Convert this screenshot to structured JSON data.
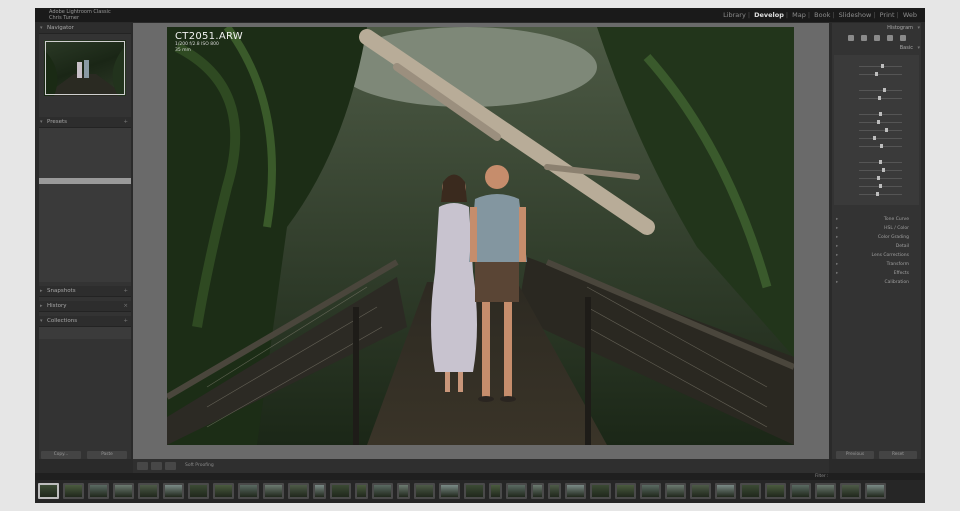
{
  "app": {
    "brand_line1": "Adobe Lightroom Classic",
    "brand_line2": "Chris Turner",
    "modules": [
      {
        "label": "Library",
        "active": false
      },
      {
        "label": "Develop",
        "active": true
      },
      {
        "label": "Map",
        "active": false
      },
      {
        "label": "Book",
        "active": false
      },
      {
        "label": "Slideshow",
        "active": false
      },
      {
        "label": "Print",
        "active": false
      },
      {
        "label": "Web",
        "active": false
      }
    ],
    "accent": "#e0e0e0"
  },
  "left_panel": {
    "navigator_label": "Navigator",
    "presets_label": "Presets",
    "snapshots_label": "Snapshots",
    "history_label": "History",
    "collections_label": "Collections",
    "copy_button": "Copy...",
    "paste_button": "Paste"
  },
  "photo": {
    "filename": "CT2051.ARW",
    "meta_line1": "1/200 f/2.8 ISO 800",
    "meta_line2": "35 mm"
  },
  "toolbar": {
    "soft_proofing": "Soft Proofing"
  },
  "right_panel": {
    "histogram_label": "Histogram",
    "basic_label": "Basic",
    "panels": [
      "Tone Curve",
      "HSL / Color",
      "Color Grading",
      "Detail",
      "Lens Corrections",
      "Transform",
      "Effects",
      "Calibration"
    ],
    "previous_button": "Previous",
    "reset_button": "Reset"
  },
  "filmstrip": {
    "filter_label": "Filter :",
    "thumb_count": 36,
    "selected_index": 0
  },
  "icons": {
    "grid": "grid-icon",
    "compare": "compare-icon",
    "crop": "crop-icon",
    "brush": "brush-icon"
  }
}
